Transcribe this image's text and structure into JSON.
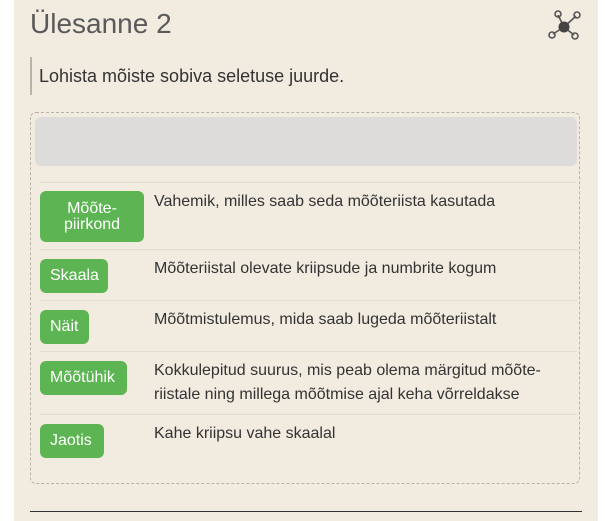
{
  "header": {
    "title": "Ülesanne 2",
    "icon": "network-nodes-icon"
  },
  "instruction": "Lohista mõiste sobiva seletuse juurde.",
  "colors": {
    "panel_bg": "#f1ebe0",
    "chip_bg": "#5cb552",
    "chip_text": "#ffffff",
    "drop_zone_bg": "#dedcda"
  },
  "rows": [
    {
      "term_line1": "Mõõte-",
      "term_line2": "piirkond",
      "description_line1": "Vahemik, milles saab seda mõõteriista kasutada",
      "description_line2": ""
    },
    {
      "term": "Skaala",
      "description_line1": "Mõõteriistal olevate kriipsude ja numbrite kogum",
      "description_line2": ""
    },
    {
      "term": "Näit",
      "description_line1": "Mõõtmistulemus, mida saab lugeda mõõteriistalt",
      "description_line2": ""
    },
    {
      "term": "Mõõtühik",
      "description_line1": "Kokkulepitud suurus, mis peab olema märgitud mõõte-",
      "description_line2": "riistale ning millega mõõtmise ajal keha võrreldakse"
    },
    {
      "term": "Jaotis",
      "description_line1": "Kahe kriipsu vahe skaalal",
      "description_line2": ""
    }
  ]
}
